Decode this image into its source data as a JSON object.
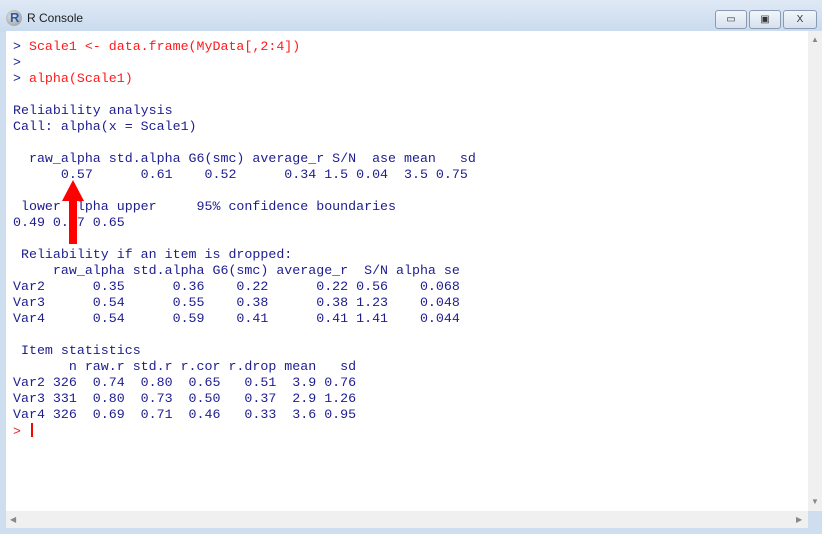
{
  "window": {
    "title": "R Console",
    "buttons": {
      "minimize": "▭",
      "maximize": "▣",
      "close": "X"
    }
  },
  "console": {
    "lines": [
      {
        "prompt": "> ",
        "text": "Scale1 <- data.frame(MyData[,2:4])",
        "type": "command"
      },
      {
        "prompt": ">",
        "text": "",
        "type": "command"
      },
      {
        "prompt": "> ",
        "text": "alpha(Scale1)",
        "type": "command"
      },
      {
        "text": "",
        "type": "output"
      },
      {
        "text": "Reliability analysis   ",
        "type": "output"
      },
      {
        "text": "Call: alpha(x = Scale1)",
        "type": "output"
      },
      {
        "text": "",
        "type": "output"
      },
      {
        "text": "  raw_alpha std.alpha G6(smc) average_r S/N  ase mean   sd",
        "type": "output"
      },
      {
        "text": "      0.57      0.61    0.52      0.34 1.5 0.04  3.5 0.75",
        "type": "output"
      },
      {
        "text": "",
        "type": "output"
      },
      {
        "text": " lower alpha upper     95% confidence boundaries",
        "type": "output"
      },
      {
        "text": "0.49 0.57 0.65 ",
        "type": "output"
      },
      {
        "text": "",
        "type": "output"
      },
      {
        "text": " Reliability if an item is dropped:",
        "type": "output"
      },
      {
        "text": "     raw_alpha std.alpha G6(smc) average_r  S/N alpha se",
        "type": "output"
      },
      {
        "text": "Var2      0.35      0.36    0.22      0.22 0.56    0.068",
        "type": "output"
      },
      {
        "text": "Var3      0.54      0.55    0.38      0.38 1.23    0.048",
        "type": "output"
      },
      {
        "text": "Var4      0.54      0.59    0.41      0.41 1.41    0.044",
        "type": "output"
      },
      {
        "text": "",
        "type": "output"
      },
      {
        "text": " Item statistics ",
        "type": "output"
      },
      {
        "text": "       n raw.r std.r r.cor r.drop mean   sd",
        "type": "output"
      },
      {
        "text": "Var2 326  0.74  0.80  0.65   0.51  3.9 0.76",
        "type": "output"
      },
      {
        "text": "Var3 331  0.80  0.73  0.50   0.37  2.9 1.26",
        "type": "output"
      },
      {
        "text": "Var4 326  0.69  0.71  0.46   0.33  3.6 0.95",
        "type": "output"
      }
    ],
    "input_prompt": "> "
  },
  "colors": {
    "command": "#ff1a1a",
    "output": "#1d1d8f",
    "annotation_arrow": "#ff0000"
  }
}
